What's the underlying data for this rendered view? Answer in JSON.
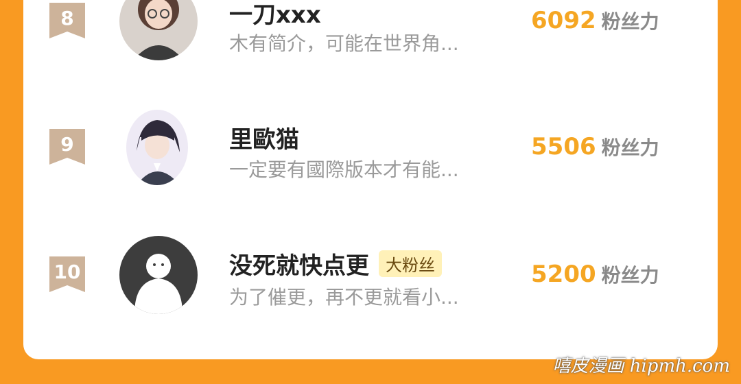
{
  "rows": [
    {
      "rank": "8",
      "name": "一刀xxx",
      "description": "木有简介，可能在世界角...",
      "fans_value": "6092",
      "fans_label": "粉丝力",
      "tag": ""
    },
    {
      "rank": "9",
      "name": "里歐猫",
      "description": "一定要有國際版本才有能...",
      "fans_value": "5506",
      "fans_label": "粉丝力",
      "tag": ""
    },
    {
      "rank": "10",
      "name": "没死就快点更",
      "description": "为了催更，再不更就看小...",
      "fans_value": "5200",
      "fans_label": "粉丝力",
      "tag": "大粉丝"
    }
  ],
  "watermark": "嘻皮漫画 hipmh.com",
  "colors": {
    "background": "#f99a22",
    "card": "#ffffff",
    "rank_badge": "#cdb39a",
    "fans_value": "#f5a623",
    "tag_bg": "#fff1b8"
  }
}
